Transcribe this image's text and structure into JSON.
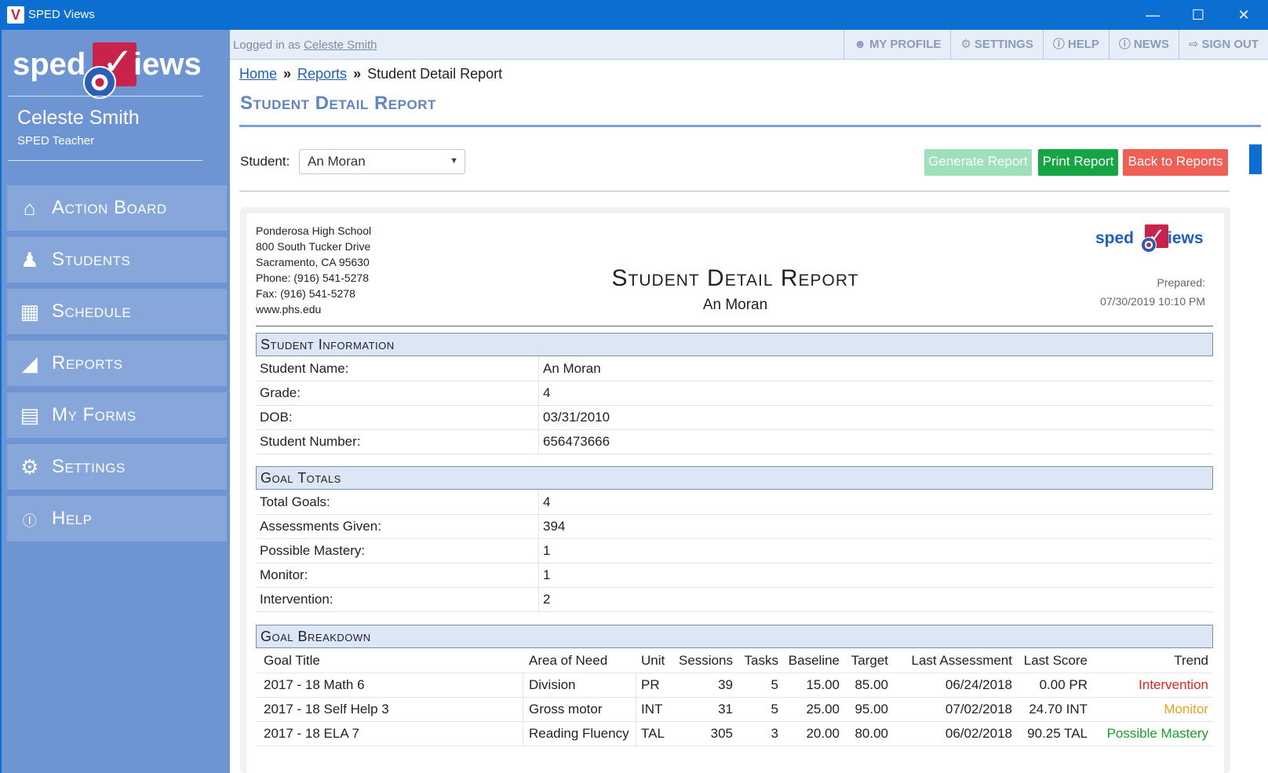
{
  "window": {
    "title": "SPED Views",
    "logo_letter": "V"
  },
  "sidebar": {
    "brand_left": "sped",
    "brand_right": "iews",
    "user_name": "Celeste Smith",
    "user_role": "SPED Teacher",
    "items": [
      {
        "label": "Action Board",
        "icon": "home-icon"
      },
      {
        "label": "Students",
        "icon": "student-icon"
      },
      {
        "label": "Schedule",
        "icon": "calendar-icon"
      },
      {
        "label": "Reports",
        "icon": "chart-icon"
      },
      {
        "label": "My Forms",
        "icon": "document-icon"
      },
      {
        "label": "Settings",
        "icon": "gear-icon"
      },
      {
        "label": "Help",
        "icon": "question-icon"
      }
    ]
  },
  "topbar": {
    "logged_prefix": "Logged in as",
    "logged_user": "Celeste Smith",
    "my_profile": "MY PROFILE",
    "settings": "SETTINGS",
    "help": "HELP",
    "news": "NEWS",
    "sign_out": "SIGN OUT"
  },
  "breadcrumb": {
    "home": "Home",
    "reports": "Reports",
    "current": "Student Detail Report",
    "sep": "»"
  },
  "page_title": "Student Detail Report",
  "controls": {
    "student_label": "Student:",
    "student_value": "An Moran",
    "generate": "Generate Report",
    "print": "Print Report",
    "back": "Back to Reports"
  },
  "report": {
    "address": [
      "Ponderosa High School",
      "800 South Tucker Drive",
      "Sacramento, CA 95630",
      "Phone: (916) 541-5278",
      "Fax: (916) 541-5278",
      "www.phs.edu"
    ],
    "title": "Student Detail Report",
    "student": "An Moran",
    "logo_left": "sped",
    "logo_right": "iews",
    "prepared_label": "Prepared:",
    "prepared_value": "07/30/2019 10:10 PM",
    "student_info": {
      "heading": "Student Information",
      "rows": [
        {
          "k": "Student Name:",
          "v": "An Moran"
        },
        {
          "k": "Grade:",
          "v": "4"
        },
        {
          "k": "DOB:",
          "v": "03/31/2010"
        },
        {
          "k": "Student Number:",
          "v": "656473666"
        }
      ]
    },
    "goal_totals": {
      "heading": "Goal Totals",
      "rows": [
        {
          "k": "Total Goals:",
          "v": "4"
        },
        {
          "k": "Assessments Given:",
          "v": "394"
        },
        {
          "k": "Possible Mastery:",
          "v": "1"
        },
        {
          "k": "Monitor:",
          "v": "1"
        },
        {
          "k": "Intervention:",
          "v": "2"
        }
      ]
    },
    "goal_breakdown": {
      "heading": "Goal Breakdown",
      "columns": [
        "Goal Title",
        "Area of Need",
        "Unit",
        "Sessions",
        "Tasks",
        "Baseline",
        "Target",
        "Last Assessment",
        "Last Score",
        "Trend"
      ],
      "rows": [
        {
          "title": "2017 - 18 Math 6",
          "area": "Division",
          "unit": "PR",
          "sessions": "39",
          "tasks": "5",
          "baseline": "15.00",
          "target": "85.00",
          "last": "06/24/2018",
          "score": "0.00 PR",
          "trend": "Intervention",
          "trend_color": "#e8201e"
        },
        {
          "title": "2017 - 18 Self Help 3",
          "area": "Gross motor",
          "unit": "INT",
          "sessions": "31",
          "tasks": "5",
          "baseline": "25.00",
          "target": "95.00",
          "last": "07/02/2018",
          "score": "24.70 INT",
          "trend": "Monitor",
          "trend_color": "#f0a21a"
        },
        {
          "title": "2017 - 18 ELA 7",
          "area": "Reading Fluency",
          "unit": "TAL",
          "sessions": "305",
          "tasks": "3",
          "baseline": "20.00",
          "target": "80.00",
          "last": "06/02/2018",
          "score": "90.25 TAL",
          "trend": "Possible Mastery",
          "trend_color": "#17a329"
        }
      ]
    }
  }
}
